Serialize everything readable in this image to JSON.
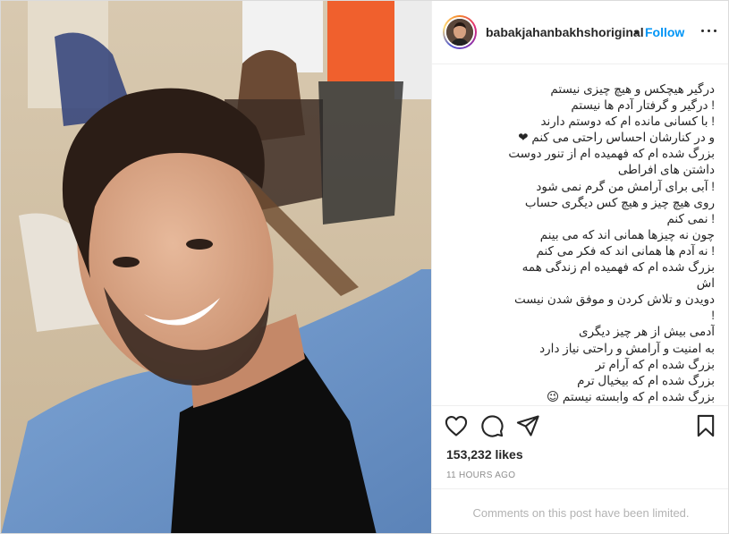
{
  "post": {
    "username": "babakjahanbakhshoriginal",
    "dot": "•",
    "follow_label": "Follow",
    "more_icon": "more-horizontal-icon",
    "caption_lines": [
      "درگیر هیچکس و هیچ چیزی نیستم",
      "! درگیر و گرفتار آدم ها نیستم",
      "! با کسانی مانده ام که دوستم دارند",
      "و در کنارشان احساس راحتی می کنم ❤",
      "بزرگ شده ام که فهمیده ام از تنور دوست",
      "داشتن های افراطی",
      "! آبی برای آرامش من گرم نمی شود",
      "روی هیچ چیز و هیچ کس دیگری حساب",
      "! نمی کنم",
      "چون نه چیزها همانی اند که می بینم",
      "! نه آدم ها همانی اند که فکر می کنم",
      "بزرگ شده ام که فهمیده ام زندگی همه",
      "اش",
      "دویدن و تلاش کردن و موفق شدن نیست",
      "!",
      "آدمی بیش از هر چیز دیگری",
      "به امنیت و آرامش و راحتی نیاز دارد",
      "بزرگ شده ام که آرام تر",
      "بزرگ شده ام که بیخیال ترم",
      "بزرگ شده ام که وابسته نیستم 😉"
    ],
    "likes": "153,232 likes",
    "time_ago": "11 HOURS AGO",
    "comments_limited": "Comments on this post have been limited.",
    "icons": {
      "like": "heart-icon",
      "comment": "comment-icon",
      "share": "share-icon",
      "save": "bookmark-icon"
    },
    "accent_color": "#0095f6"
  }
}
